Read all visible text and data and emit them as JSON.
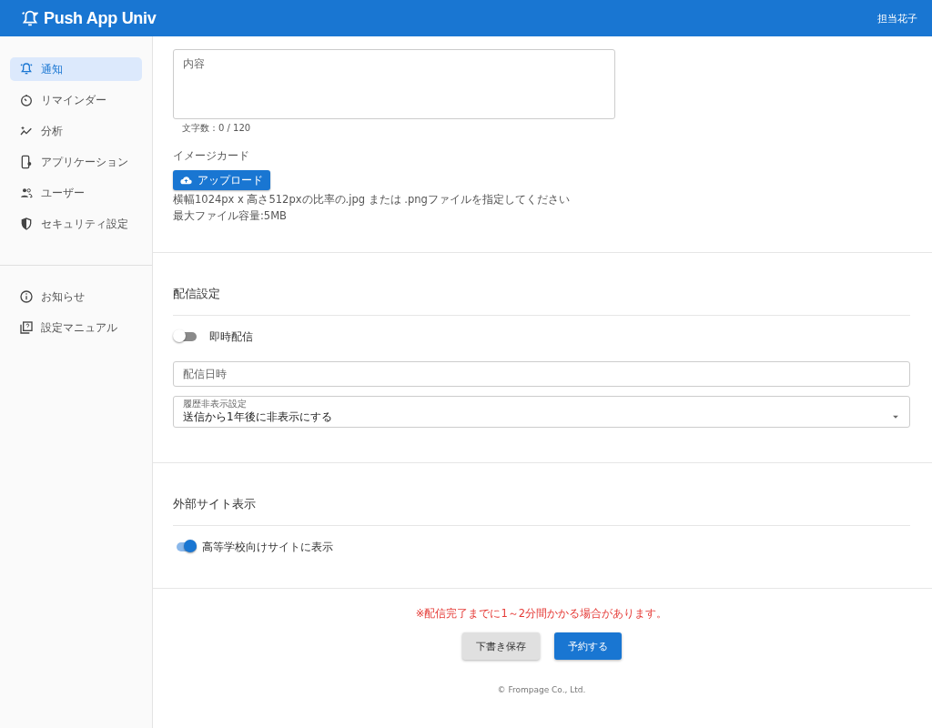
{
  "header": {
    "app_name": "Push App Univ",
    "user": "担当花子"
  },
  "sidebar": {
    "groups": [
      [
        {
          "label": "通知",
          "selected": true
        },
        {
          "label": "リマインダー",
          "selected": false
        },
        {
          "label": "分析",
          "selected": false
        },
        {
          "label": "アプリケーション",
          "selected": false
        },
        {
          "label": "ユーザー",
          "selected": false
        },
        {
          "label": "セキュリティ設定",
          "selected": false
        }
      ],
      [
        {
          "label": "お知らせ",
          "selected": false
        },
        {
          "label": "設定マニュアル",
          "selected": false
        }
      ]
    ]
  },
  "content_section": {
    "content_field": {
      "placeholder": "内容"
    },
    "char_count": "文字数：0 / 120",
    "image_card_label": "イメージカード",
    "upload_button": "アップロード",
    "hints": [
      "横幅1024px x 高さ512pxの比率の.jpg または .pngファイルを指定してください",
      "最大ファイル容量:5MB"
    ]
  },
  "delivery_settings": {
    "title": "配信設定",
    "immediate": {
      "label": "即時配信",
      "on": false
    },
    "datetime_field": {
      "placeholder": "配信日時"
    },
    "hide_history": {
      "label": "履歴非表示設定",
      "value": "送信から1年後に非表示にする"
    }
  },
  "external_site": {
    "title": "外部サイト表示",
    "high_school_site": {
      "label": "高等学校向けサイトに表示",
      "on": true
    }
  },
  "footer_actions": {
    "notice": "※配信完了までに1～2分間かかる場合があります。",
    "buttons": [
      {
        "label": "下書き保存",
        "kind": "secondary"
      },
      {
        "label": "予約する",
        "kind": "primary"
      }
    ],
    "copyright": "© Frompage Co., Ltd."
  }
}
